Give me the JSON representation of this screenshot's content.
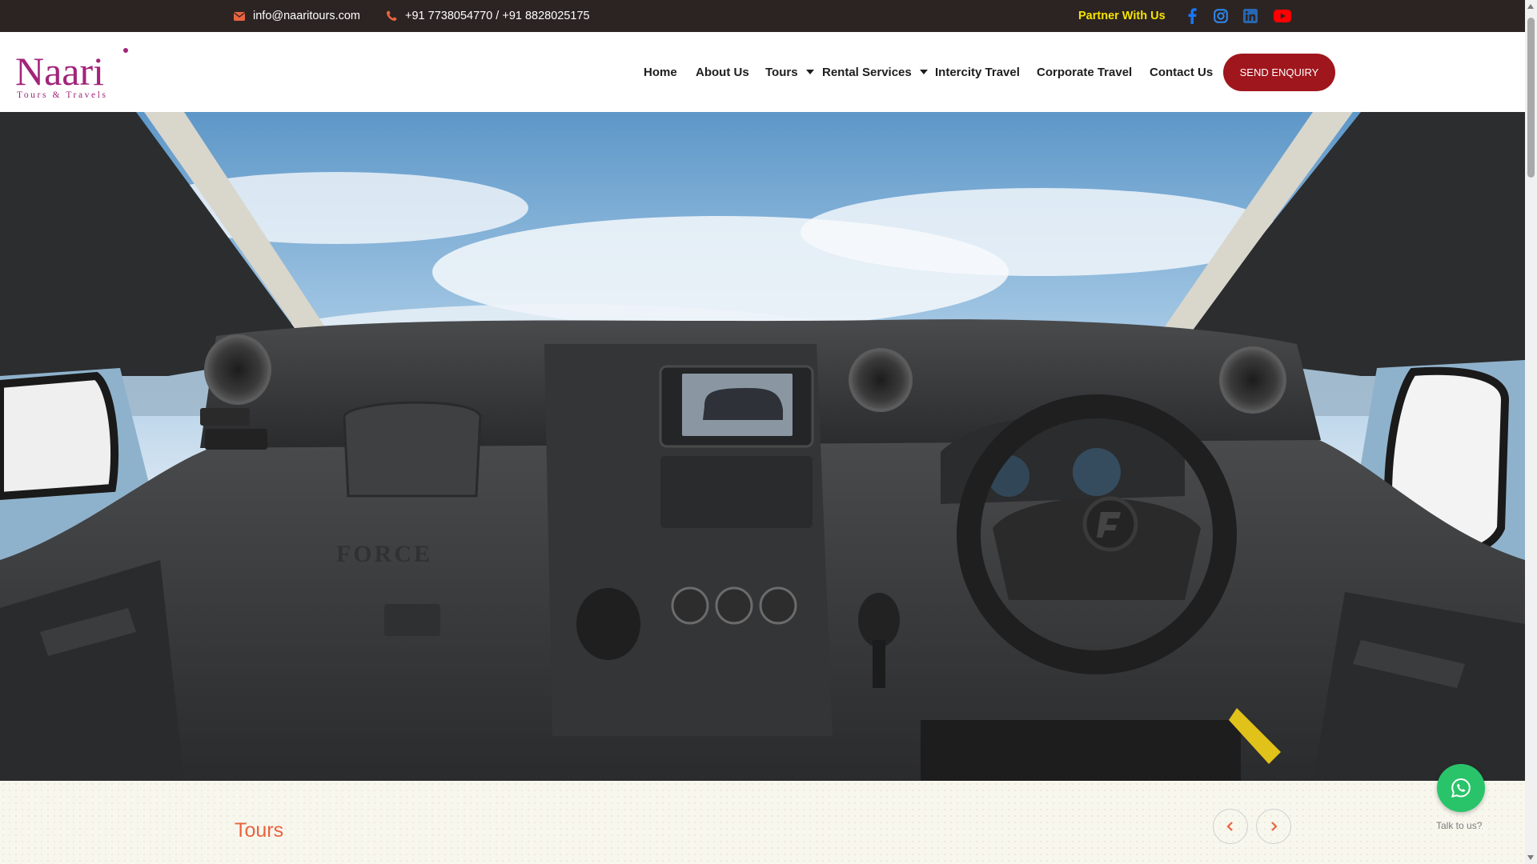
{
  "topbar": {
    "email": "info@naaritours.com",
    "phone": "+91 7738054770 / +91 8828025175",
    "partner_label": "Partner With Us",
    "social": [
      "facebook-icon",
      "instagram-icon",
      "linkedin-icon",
      "youtube-icon"
    ]
  },
  "logo": {
    "name": "Naari",
    "tagline": "Tours & Travels"
  },
  "nav": {
    "items": [
      {
        "label": "Home"
      },
      {
        "label": "About Us"
      },
      {
        "label": "Tours",
        "dropdown": true
      },
      {
        "label": "Rental Services",
        "dropdown": true
      },
      {
        "label": "Intercity Travel"
      },
      {
        "label": "Corporate Travel"
      },
      {
        "label": "Contact Us"
      }
    ],
    "cta_label": "SEND ENQUIRY"
  },
  "hero": {
    "brand_on_dashboard": "FORCE"
  },
  "tours": {
    "title": "Tours"
  },
  "whatsapp": {
    "label": "Talk to us?"
  },
  "colors": {
    "topbar_bg": "#2c2423",
    "partner": "#f5e400",
    "accent_orange": "#e8643e",
    "cta_red": "#a0161d",
    "logo_magenta": "#a2247a",
    "whatsapp_green": "#29c46a",
    "facebook": "#1877f2",
    "instagram": "#2d89ef",
    "linkedin": "#2867b2",
    "youtube": "#ff0000"
  }
}
